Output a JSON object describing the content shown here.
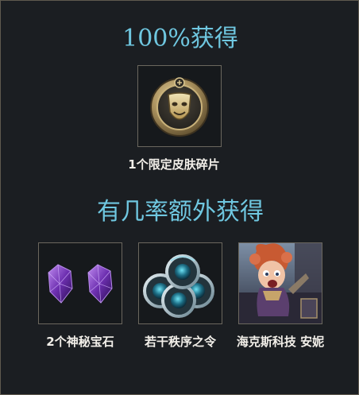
{
  "guaranteed": {
    "title": "100%获得",
    "reward": {
      "label": "1个限定皮肤碎片",
      "icon": "skin-shard-mask-icon"
    }
  },
  "bonus": {
    "title": "有几率额外获得",
    "rewards": [
      {
        "label": "2个神秘宝石",
        "icon": "purple-gemstones-icon"
      },
      {
        "label": "若干秩序之令",
        "icon": "order-tokens-icon"
      },
      {
        "label": "海克斯科技 安妮",
        "icon": "hextech-annie-portrait"
      }
    ]
  },
  "colors": {
    "accent": "#6fc7e0",
    "background": "#1b1e22",
    "frame_border": "#6b675e",
    "caption_text": "#f2efe9"
  }
}
